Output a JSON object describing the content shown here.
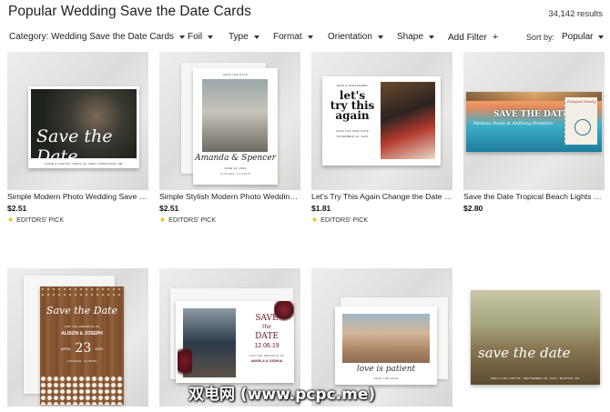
{
  "header": {
    "title": "Popular Wedding Save the Date Cards",
    "result_count": "34,142 results"
  },
  "filters": {
    "category": "Category: Wedding Save the Date Cards",
    "foil": "Foil",
    "type": "Type",
    "format": "Format",
    "orientation": "Orientation",
    "shape": "Shape",
    "add_filter": "Add Filter",
    "add_filter_icon": "+",
    "sort_label": "Sort by:",
    "sort_value": "Popular"
  },
  "products": [
    {
      "title": "Simple Modern Photo Wedding Save the Date",
      "price": "$2.51",
      "badge": "EDITORS' PICK",
      "card_text": {
        "headline": "Save the Date",
        "footer": "KATIE & JUSTIN • APRIL 16, 2025 • PORTLAND, OR"
      }
    },
    {
      "title": "Simple Stylish Modern Photo Wedding Save the Date",
      "price": "$2.51",
      "badge": "EDITORS' PICK",
      "card_text": {
        "top": "SAVE THE DATE",
        "names": "Amanda & Spencer",
        "date": "JUNE 24, 2023",
        "place": "CHICAGO, ILLINOIS"
      }
    },
    {
      "title": "Let's Try This Again Change the Date Wedding",
      "price": "$1.81",
      "badge": "EDITORS' PICK",
      "card_text": {
        "names": "ERIN & ALEXANDER",
        "headline_1": "let's",
        "headline_2": "try this",
        "headline_3": "again",
        "sub": "SAVE THE NEW DATE",
        "date": "NOVEMBER 16, 2025"
      }
    },
    {
      "title": "Save the Date Tropical Beach Lights Boarding Pass",
      "price": "$2.80",
      "badge": "",
      "card_text": {
        "headline": "SAVE THE DATE",
        "names": "Melissa Paulo & Anthony Brandon",
        "stamp": "Passport Ready"
      }
    },
    {
      "title": "",
      "price": "",
      "badge": "",
      "card_text": {
        "headline": "Save the Date",
        "sub": "FOR THE WEDDING OF",
        "names": "ALISON & JOSEPH",
        "month": "APRIL",
        "day": "23",
        "year": "2023",
        "place": "CHICAGO, ILLINOIS"
      }
    },
    {
      "title": "",
      "price": "",
      "badge": "",
      "card_text": {
        "save": "SAVE",
        "the": "the",
        "date": "DATE",
        "numeric": "12.06.19",
        "sub": "FOR THE WEDDING OF",
        "names": "ANGELA & JOSHUA"
      }
    },
    {
      "title": "",
      "price": "",
      "badge": "",
      "card_text": {
        "headline": "love is patient",
        "sub": "SAVE THE DATE"
      }
    },
    {
      "title": "",
      "price": "",
      "badge": "",
      "card_text": {
        "headline": "save the date",
        "footer": "EMILY AND JUSTIN • SEPTEMBER 18, 2025 • BOSTON, MA"
      }
    }
  ],
  "watermark": "双电网 (www.pcpc.me)",
  "colors": {
    "star": "#f2b600",
    "tile_bg": "#e7e6e4",
    "wood": "#8a5a36",
    "beach": "#3fb0c8"
  },
  "icons": [
    "chevron-down-icon",
    "plus-icon",
    "star-icon"
  ]
}
